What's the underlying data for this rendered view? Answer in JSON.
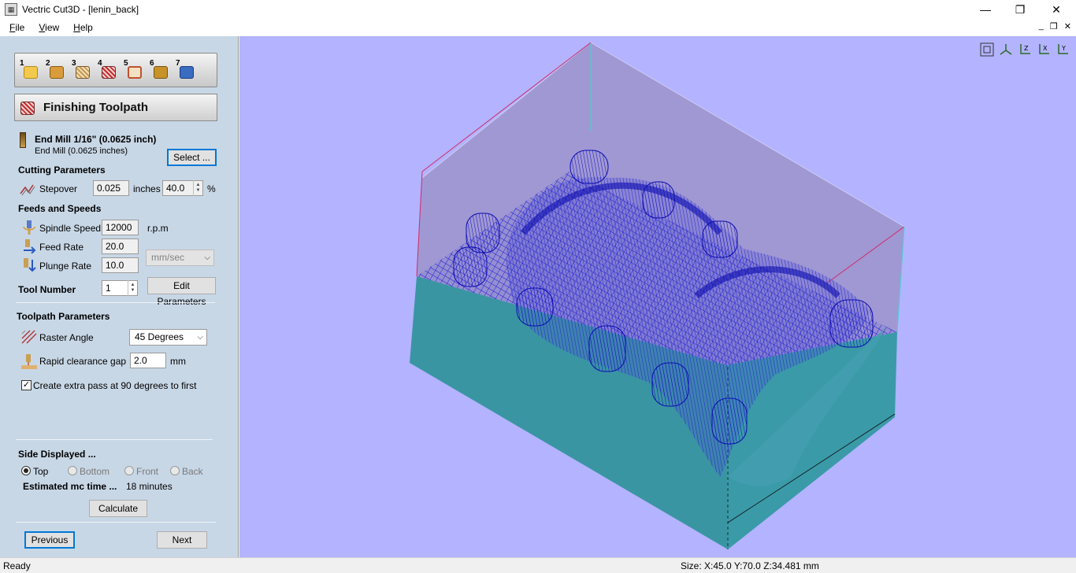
{
  "window": {
    "title": "Vectric Cut3D - [lenin_back]",
    "minimize": "—",
    "maximize": "❐",
    "close": "✕"
  },
  "menu": {
    "file": "File",
    "view": "View",
    "help": "Help"
  },
  "toolbar": {
    "steps": [
      "1",
      "2",
      "3",
      "4",
      "5",
      "6",
      "7"
    ]
  },
  "panel": {
    "title": "Finishing Toolpath",
    "tool": {
      "name": "End Mill 1/16\" (0.0625 inch)",
      "desc": "End Mill (0.0625 inches)",
      "select_label": "Select ..."
    },
    "cutting": {
      "heading": "Cutting Parameters",
      "stepover_label": "Stepover",
      "stepover_value": "0.025",
      "stepover_unit": "inches",
      "stepover_percent": "40.0",
      "percent_sign": "%"
    },
    "feeds": {
      "heading": "Feeds and Speeds",
      "spindle_label": "Spindle Speed",
      "spindle_value": "12000",
      "spindle_unit": "r.p.m",
      "feed_label": "Feed Rate",
      "feed_value": "20.0",
      "rate_unit": "mm/sec",
      "plunge_label": "Plunge Rate",
      "plunge_value": "10.0"
    },
    "tool_number": {
      "label": "Tool Number",
      "value": "1",
      "edit_label": "Edit Parameters"
    },
    "toolpath": {
      "heading": "Toolpath Parameters",
      "raster_label": "Raster Angle",
      "raster_value": "45 Degrees",
      "rapid_label": "Rapid clearance gap",
      "rapid_value": "2.0",
      "rapid_unit": "mm",
      "extra_pass_label": "Create extra pass at 90 degrees to first"
    },
    "side": {
      "heading": "Side Displayed ...",
      "top": "Top",
      "bottom": "Bottom",
      "front": "Front",
      "back": "Back",
      "time_label": "Estimated mc time ...",
      "time_value": "18 minutes",
      "calculate_label": "Calculate"
    },
    "nav": {
      "previous": "Previous",
      "next": "Next"
    }
  },
  "status": {
    "left": "Ready",
    "size": "Size: X:45.0 Y:70.0 Z:34.481 mm"
  },
  "colors": {
    "panel_bg": "#c8d7e6",
    "viewport_bg": "#b3b3ff",
    "block_side": "#3a95a3",
    "toolpath": "#1a1ad0"
  }
}
